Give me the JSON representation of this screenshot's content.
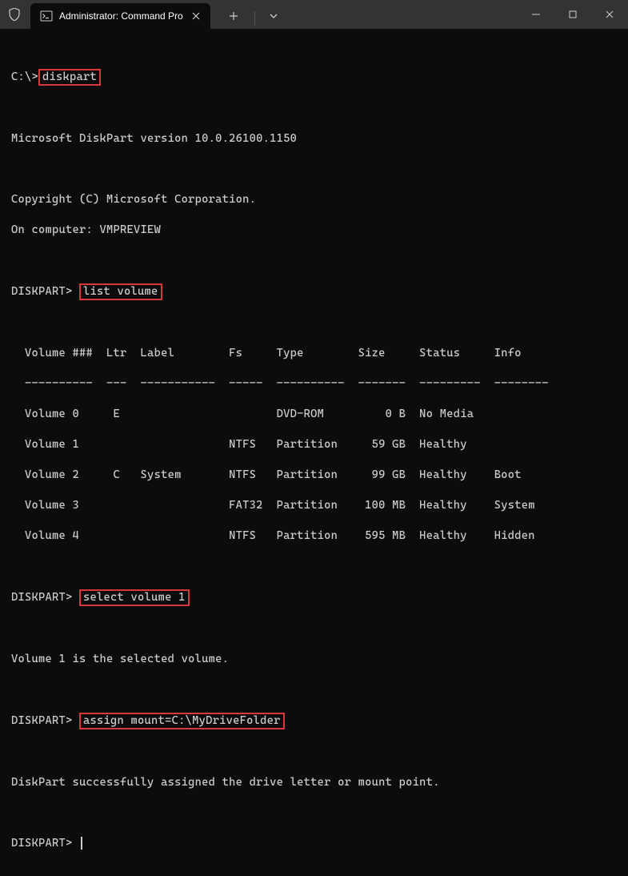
{
  "tab": {
    "title": "Administrator: Command Pro"
  },
  "terminal": {
    "prompt_initial": "C:\\>",
    "cmd_diskpart": "diskpart",
    "blank": "",
    "version_line": "Microsoft DiskPart version 10.0.26100.1150",
    "copyright_line": "Copyright (C) Microsoft Corporation.",
    "computer_line": "On computer: VMPREVIEW",
    "prompt_diskpart": "DISKPART> ",
    "cmd_list_volume": "list volume",
    "table_header": "  Volume ###  Ltr  Label        Fs     Type        Size     Status     Info",
    "table_divider": "  ----------  ---  -----------  -----  ----------  -------  ---------  --------",
    "table_rows": [
      "  Volume 0     E                       DVD-ROM         0 B  No Media",
      "  Volume 1                      NTFS   Partition     59 GB  Healthy",
      "  Volume 2     C   System       NTFS   Partition     99 GB  Healthy    Boot",
      "  Volume 3                      FAT32  Partition    100 MB  Healthy    System",
      "  Volume 4                      NTFS   Partition    595 MB  Healthy    Hidden"
    ],
    "cmd_select_volume": "select volume 1",
    "select_result": "Volume 1 is the selected volume.",
    "cmd_assign": "assign mount=C:\\MyDriveFolder",
    "assign_result": "DiskPart successfully assigned the drive letter or mount point."
  }
}
